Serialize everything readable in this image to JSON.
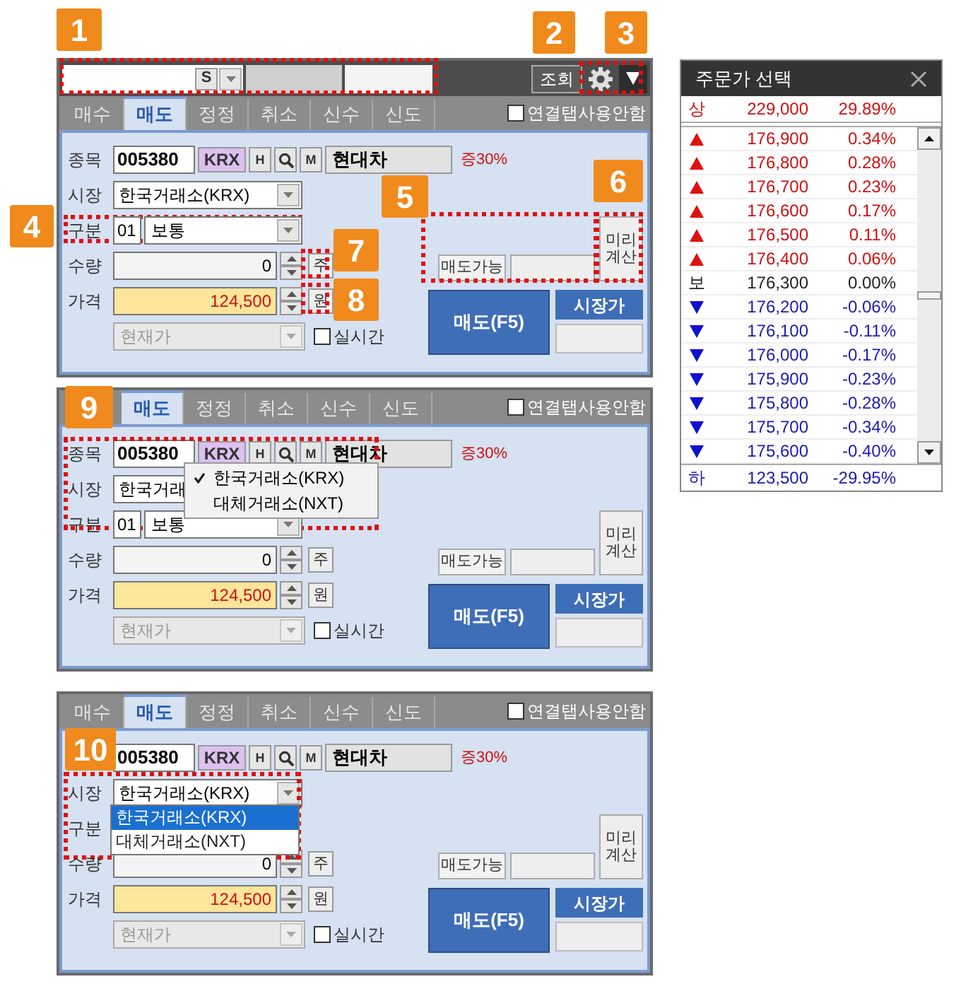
{
  "callouts": [
    "1",
    "2",
    "3",
    "4",
    "5",
    "6",
    "7",
    "8",
    "9",
    "10"
  ],
  "panels": [
    {
      "toolbar": {
        "code_button": "S",
        "query_button": "조회"
      },
      "tabs": [
        {
          "label": "매수",
          "selected": false
        },
        {
          "label": "매도",
          "selected": true
        },
        {
          "label": "정정",
          "selected": false
        },
        {
          "label": "취소",
          "selected": false
        },
        {
          "label": "신수",
          "selected": false
        },
        {
          "label": "신도",
          "selected": false
        }
      ],
      "link_tab": {
        "label": "연결탭사용안함",
        "checked": false
      },
      "form": {
        "stock_label": "종목",
        "stock_code": "005380",
        "exchange": "KRX",
        "h_button": "H",
        "m_button": "M",
        "stock_name": "현대차",
        "margin": "증30%",
        "market_label": "시장",
        "market_value": "한국거래소(KRX)",
        "order_type_label": "구분",
        "order_type_code": "01",
        "order_type_name": "보통",
        "qty_label": "수량",
        "qty": "0",
        "qty_unit": "주",
        "price_label": "가격",
        "price": "124,500",
        "price_unit": "원",
        "price_type": "현재가",
        "realtime": {
          "label": "실시간",
          "checked": false
        },
        "sellable_label": "매도가능",
        "precalc_button": "미리계산",
        "sell_button": "매도(F5)",
        "market_price_button": "시장가"
      }
    },
    {
      "tabs": [
        {
          "label": "매도",
          "selected": true
        },
        {
          "label": "정정",
          "selected": false
        },
        {
          "label": "취소",
          "selected": false
        },
        {
          "label": "신수",
          "selected": false
        },
        {
          "label": "신도",
          "selected": false
        }
      ],
      "link_tab": {
        "label": "연결탭사용안함",
        "checked": false
      },
      "form": {
        "stock_label": "종목",
        "stock_code": "005380",
        "exchange": "KRX",
        "h_button": "H",
        "m_button": "M",
        "stock_name": "현대차",
        "margin": "증30%",
        "market_label": "시장",
        "market_value": "한국거래",
        "order_type_label": "구분",
        "order_type_code": "01",
        "order_type_name": "보통",
        "qty_label": "수량",
        "qty": "0",
        "qty_unit": "주",
        "price_label": "가격",
        "price": "124,500",
        "price_unit": "원",
        "price_type": "현재가",
        "realtime": {
          "label": "실시간",
          "checked": false
        },
        "sellable_label": "매도가능",
        "precalc_button": "미리계산",
        "sell_button": "매도(F5)",
        "market_price_button": "시장가"
      },
      "popup": {
        "kind": "menu",
        "items": [
          {
            "label": "한국거래소(KRX)",
            "selected": true
          },
          {
            "label": "대체거래소(NXT)",
            "selected": false
          }
        ]
      }
    },
    {
      "tabs": [
        {
          "label": "매수",
          "selected": false
        },
        {
          "label": "매도",
          "selected": true
        },
        {
          "label": "정정",
          "selected": false
        },
        {
          "label": "취소",
          "selected": false
        },
        {
          "label": "신수",
          "selected": false
        },
        {
          "label": "신도",
          "selected": false
        }
      ],
      "link_tab": {
        "label": "연결탭사용안함",
        "checked": false
      },
      "form": {
        "stock_code": "005380",
        "exchange": "KRX",
        "h_button": "H",
        "m_button": "M",
        "stock_name": "현대차",
        "margin": "증30%",
        "market_label": "시장",
        "market_value": "한국거래소(KRX)",
        "order_type_label": "구분",
        "qty_label": "수량",
        "qty": "0",
        "qty_unit": "주",
        "price_label": "가격",
        "price": "124,500",
        "price_unit": "원",
        "price_type": "현재가",
        "realtime": {
          "label": "실시간",
          "checked": false
        },
        "sellable_label": "매도가능",
        "precalc_button": "미리계산",
        "sell_button": "매도(F5)",
        "market_price_button": "시장가"
      },
      "popup": {
        "kind": "list",
        "items": [
          {
            "label": "한국거래소(KRX)",
            "selected": true
          },
          {
            "label": "대체거래소(NXT)",
            "selected": false
          }
        ]
      }
    }
  ],
  "price_picker": {
    "title": "주문가 선택",
    "upper": {
      "label": "상",
      "price": "229,000",
      "change": "29.89%"
    },
    "rows": [
      {
        "kind": "up",
        "price": "176,900",
        "change": "0.34%"
      },
      {
        "kind": "up",
        "price": "176,800",
        "change": "0.28%"
      },
      {
        "kind": "up",
        "price": "176,700",
        "change": "0.23%"
      },
      {
        "kind": "up",
        "price": "176,600",
        "change": "0.17%"
      },
      {
        "kind": "up",
        "price": "176,500",
        "change": "0.11%"
      },
      {
        "kind": "up",
        "price": "176,400",
        "change": "0.06%"
      },
      {
        "kind": "base",
        "label": "보",
        "price": "176,300",
        "change": "0.00%"
      },
      {
        "kind": "down",
        "price": "176,200",
        "change": "-0.06%"
      },
      {
        "kind": "down",
        "price": "176,100",
        "change": "-0.11%"
      },
      {
        "kind": "down",
        "price": "176,000",
        "change": "-0.17%"
      },
      {
        "kind": "down",
        "price": "175,900",
        "change": "-0.23%"
      },
      {
        "kind": "down",
        "price": "175,800",
        "change": "-0.28%"
      },
      {
        "kind": "down",
        "price": "175,700",
        "change": "-0.34%"
      },
      {
        "kind": "down",
        "price": "175,600",
        "change": "-0.40%"
      }
    ],
    "lower": {
      "label": "하",
      "price": "123,500",
      "change": "-29.95%"
    }
  }
}
